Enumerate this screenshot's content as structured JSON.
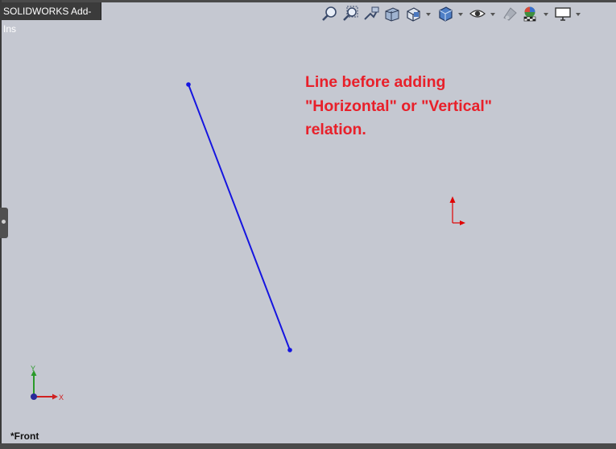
{
  "panel": {
    "addins_label": "SOLIDWORKS Add-Ins"
  },
  "toolbar": {
    "icons": [
      "zoom-to-fit-icon",
      "zoom-to-area-icon",
      "previous-view-icon",
      "section-view-icon",
      "view-orientation-icon",
      "display-style-icon",
      "hide-show-items-icon",
      "edit-appearance-icon",
      "apply-scene-icon",
      "view-settings-icon"
    ]
  },
  "annotation": {
    "lines": [
      "Line before adding",
      "\"Horizontal\" or \"Vertical\"",
      "relation."
    ],
    "color": "#e8202a"
  },
  "sketch": {
    "line_color": "#1515e0",
    "origin_color": "#e00000"
  },
  "triad": {
    "x_label": "X",
    "y_label": "Y",
    "x_color": "#d02020",
    "y_color": "#2a9a2a"
  },
  "view": {
    "label": "*Front"
  },
  "colors": {
    "background": "#c5c8d1",
    "frame": "#4a4a4a"
  }
}
